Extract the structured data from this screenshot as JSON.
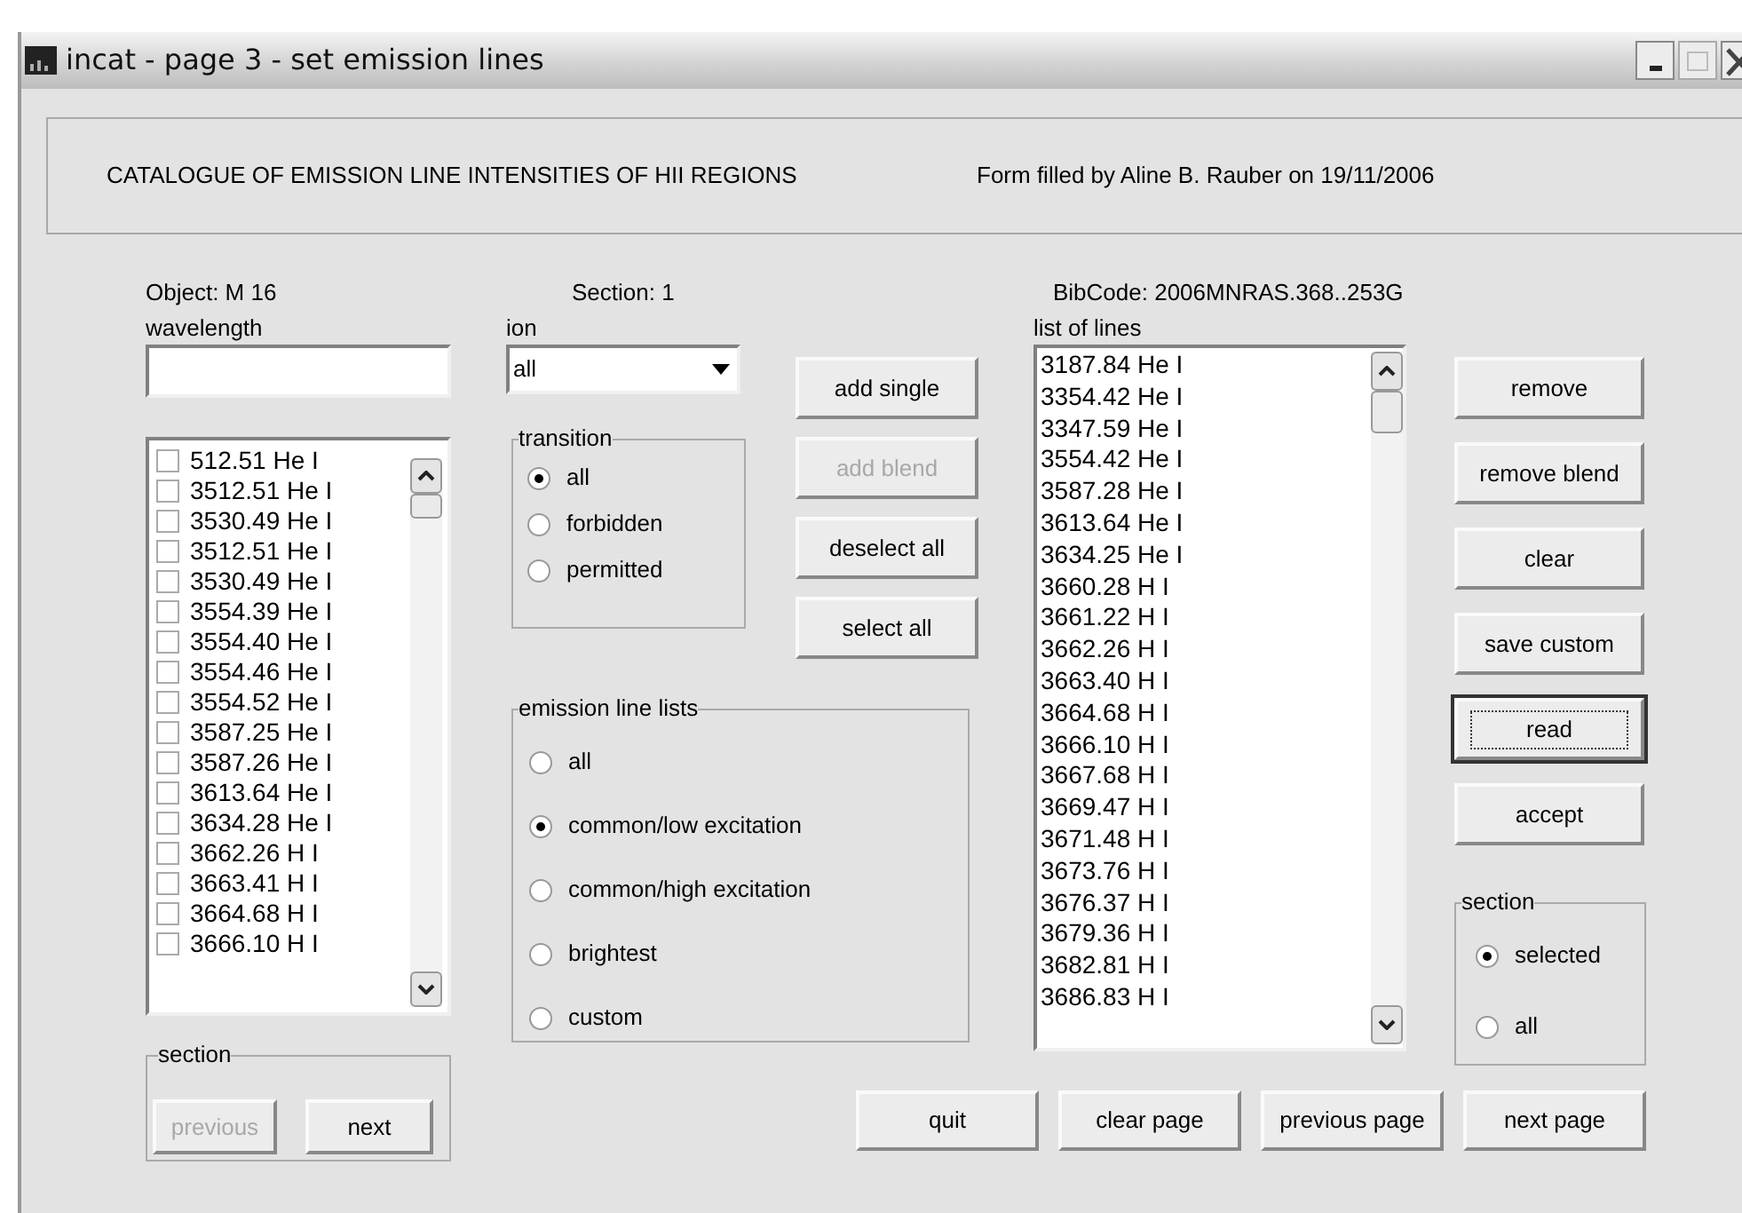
{
  "window": {
    "title": "incat - page 3 - set emission lines"
  },
  "header": {
    "catalogue": "CATALOGUE OF EMISSION LINE INTENSITIES OF HII REGIONS",
    "form_filled": "Form filled by  Aline B. Rauber on 19/11/2006"
  },
  "info": {
    "object": "Object: M 16",
    "section": "Section: 1",
    "bibcode": "BibCode: 2006MNRAS.368..253G"
  },
  "wavelength": {
    "label": "wavelength"
  },
  "available_lines": [
    {
      "label": "512.51 He I",
      "checked": false
    },
    {
      "label": "3512.51 He I",
      "checked": false
    },
    {
      "label": "3530.49 He I",
      "checked": false
    },
    {
      "label": "3512.51 He I",
      "checked": false
    },
    {
      "label": "3530.49 He I",
      "checked": false
    },
    {
      "label": "3554.39 He I",
      "checked": false
    },
    {
      "label": "3554.40 He I",
      "checked": false
    },
    {
      "label": "3554.46 He I",
      "checked": false
    },
    {
      "label": "3554.52 He I",
      "checked": false
    },
    {
      "label": "3587.25 He I",
      "checked": false
    },
    {
      "label": "3587.26 He I",
      "checked": false
    },
    {
      "label": "3613.64 He I",
      "checked": false
    },
    {
      "label": "3634.28 He I",
      "checked": false
    },
    {
      "label": "3662.26 H I",
      "checked": false
    },
    {
      "label": "3663.41 H I",
      "checked": false
    },
    {
      "label": "3664.68 H I",
      "checked": false
    },
    {
      "label": "3666.10 H I",
      "checked": false
    }
  ],
  "left_section": {
    "title": "section",
    "buttons": [
      {
        "label": "previous",
        "disabled": true
      },
      {
        "label": "next",
        "disabled": false
      }
    ]
  },
  "ion": {
    "label": "ion",
    "value": "all"
  },
  "transition": {
    "title": "transition",
    "options": [
      {
        "label": "all",
        "selected": true
      },
      {
        "label": "forbidden",
        "selected": false
      },
      {
        "label": "permitted",
        "selected": false
      }
    ]
  },
  "middle_buttons": [
    {
      "label": "add single",
      "disabled": false
    },
    {
      "label": "add blend",
      "disabled": true
    },
    {
      "label": "deselect all",
      "disabled": false
    },
    {
      "label": "select all",
      "disabled": false
    }
  ],
  "emission_line_lists": {
    "title": "emission line lists",
    "options": [
      {
        "label": "all",
        "selected": false
      },
      {
        "label": "common/low excitation",
        "selected": true
      },
      {
        "label": "common/high excitation",
        "selected": false
      },
      {
        "label": "brightest",
        "selected": false
      },
      {
        "label": "custom",
        "selected": false
      }
    ]
  },
  "list_of_lines": {
    "label": "list of lines",
    "items": [
      "3187.84 He I",
      "3354.42 He I",
      "3347.59 He I",
      "3554.42 He I",
      "3587.28 He I",
      "3613.64 He I",
      "3634.25 He I",
      "3660.28 H I",
      "3661.22 H I",
      "3662.26 H I",
      "3663.40 H I",
      "3664.68 H I",
      "3666.10 H I",
      "3667.68 H I",
      "3669.47 H I",
      "3671.48 H I",
      "3673.76 H I",
      "3676.37 H I",
      "3679.36 H I",
      "3682.81 H I",
      "3686.83 H I"
    ]
  },
  "right_buttons": [
    {
      "label": "remove",
      "focused": false
    },
    {
      "label": "remove blend",
      "focused": false
    },
    {
      "label": "clear",
      "focused": false
    },
    {
      "label": "save custom",
      "focused": false
    },
    {
      "label": "read",
      "focused": true
    },
    {
      "label": "accept",
      "focused": false
    }
  ],
  "right_section": {
    "title": "section",
    "options": [
      {
        "label": "selected",
        "selected": true
      },
      {
        "label": "all",
        "selected": false
      }
    ]
  },
  "bottom_buttons": [
    "quit",
    "clear page",
    "previous page",
    "next page"
  ]
}
